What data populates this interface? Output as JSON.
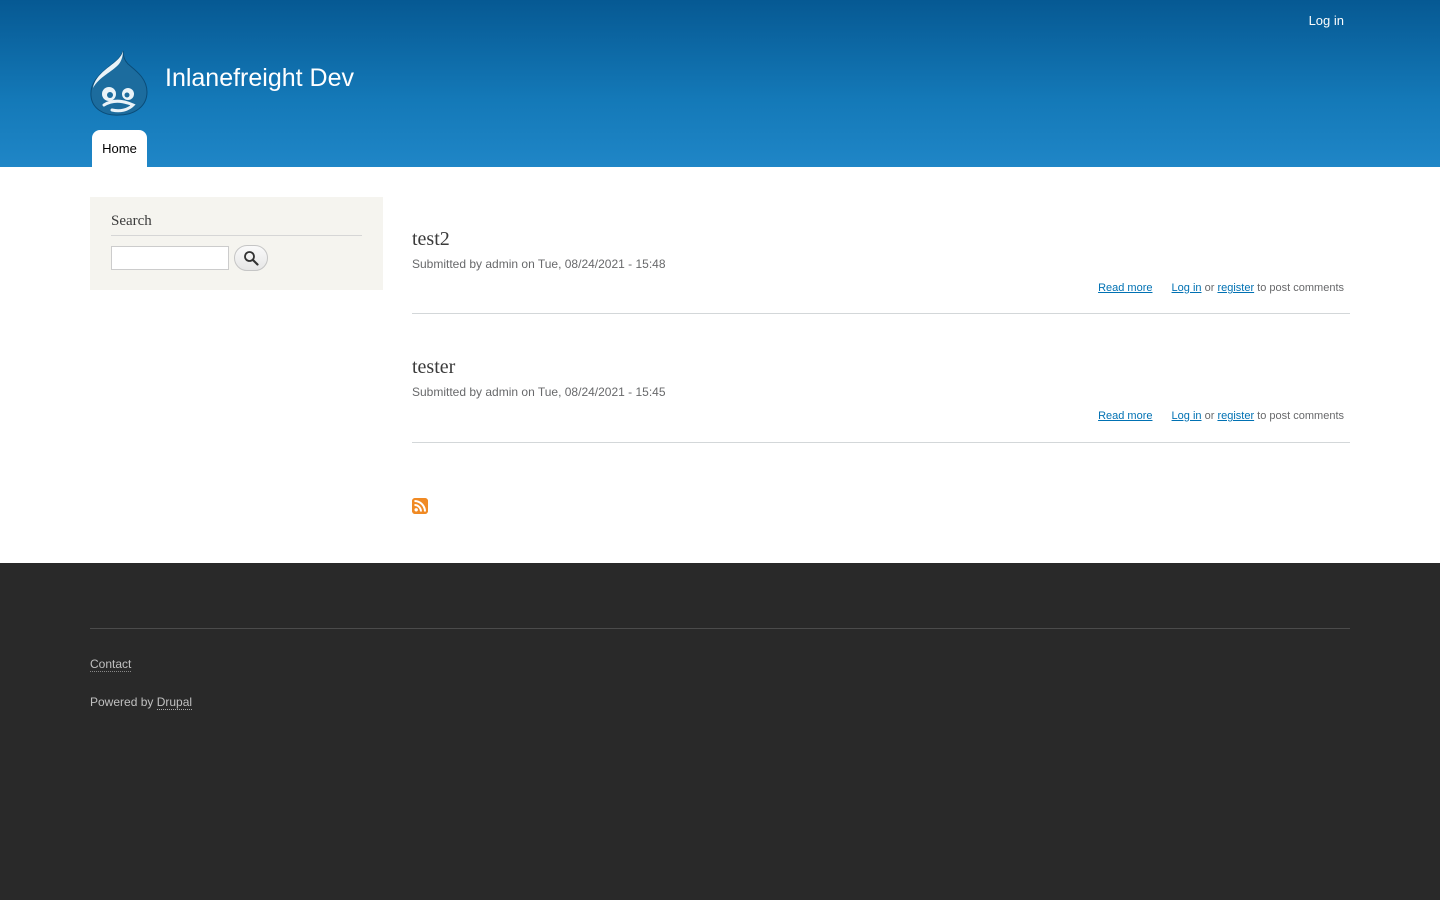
{
  "header": {
    "login_link": "Log in",
    "site_name": "Inlanefreight Dev",
    "logo_icon": "drupal-drop-icon",
    "nav": [
      {
        "label": "Home"
      }
    ]
  },
  "sidebar": {
    "search_title": "Search",
    "search_placeholder": "",
    "search_button_icon": "magnifier-icon"
  },
  "nodes": [
    {
      "title": "test2",
      "submitted_prefix": "Submitted by ",
      "author": "admin",
      "submitted_on": " on Tue, 08/24/2021 - 15:48",
      "read_more": "Read more",
      "log_in": "Log in",
      "or": " or ",
      "register": "register",
      "post_comments": " to post comments"
    },
    {
      "title": "tester",
      "submitted_prefix": "Submitted by ",
      "author": "admin",
      "submitted_on": " on Tue, 08/24/2021 - 15:45",
      "read_more": "Read more",
      "log_in": "Log in",
      "or": " or ",
      "register": "register",
      "post_comments": " to post comments"
    }
  ],
  "feed_icon": "rss-feed-icon",
  "footer": {
    "contact": "Contact",
    "powered_by": "Powered by ",
    "drupal": "Drupal"
  },
  "colors": {
    "header_top": "#065993",
    "header_bottom": "#1f86c7",
    "link": "#0071b3",
    "footer_bg": "#292929",
    "sidebar_bg": "#f5f4ef",
    "feed": "#f08a24"
  }
}
